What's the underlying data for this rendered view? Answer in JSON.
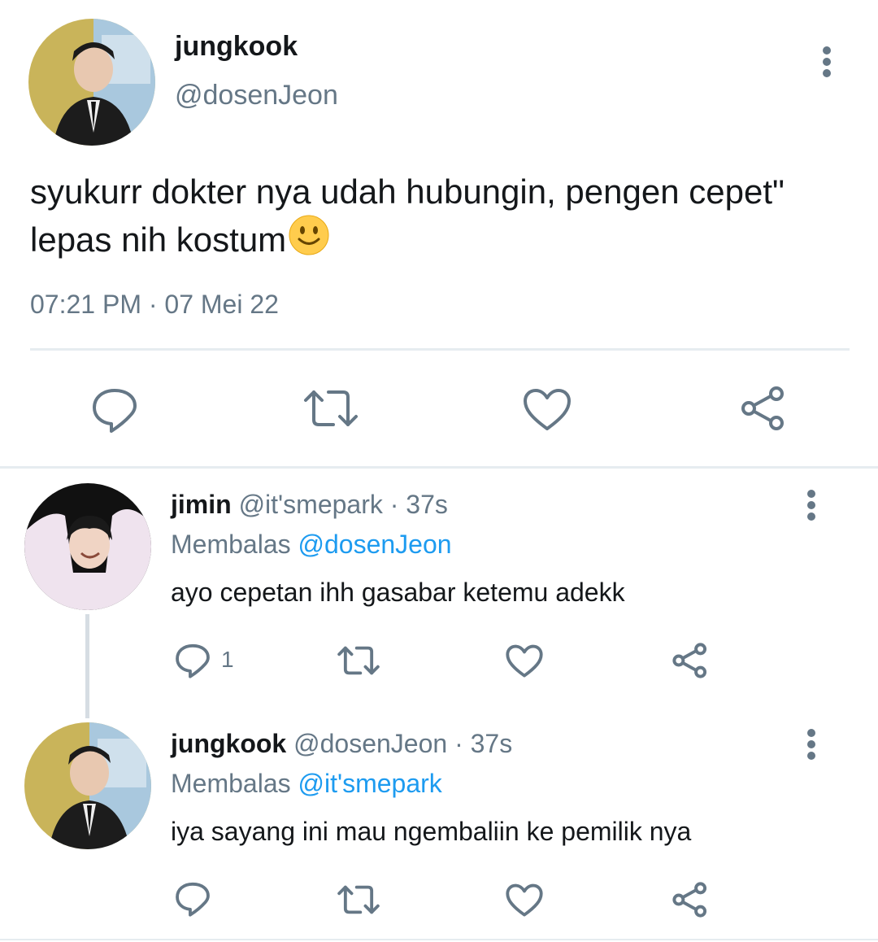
{
  "main_tweet": {
    "display_name": "jungkook",
    "handle": "@dosenJeon",
    "text_line1": "syukurr dokter nya udah hubungin, pengen cepet\"",
    "text_line2": "lepas nih kostum",
    "emoji": "🙂",
    "time": "07:21 PM",
    "separator": "·",
    "date": "07 Mei 22",
    "actions": [
      "reply-icon",
      "retweet-icon",
      "like-icon",
      "share-icon"
    ]
  },
  "replies": [
    {
      "display_name": "jimin",
      "handle": "@it'smepark",
      "age": "· 37s",
      "replying_prefix": "Membalas",
      "replying_to": "@dosenJeon",
      "text": "ayo cepetan ihh gasabar ketemu adekk",
      "reply_count": "1"
    },
    {
      "display_name": "jungkook",
      "handle": "@dosenJeon",
      "age": "· 37s",
      "replying_prefix": "Membalas",
      "replying_to": "@it'smepark",
      "text": "iya sayang ini mau ngembaliin ke pemilik nya",
      "reply_count": ""
    }
  ],
  "colors": {
    "icon_gray": "#657786",
    "link_blue": "#1d9bf0",
    "divider": "#e6ecf0"
  }
}
